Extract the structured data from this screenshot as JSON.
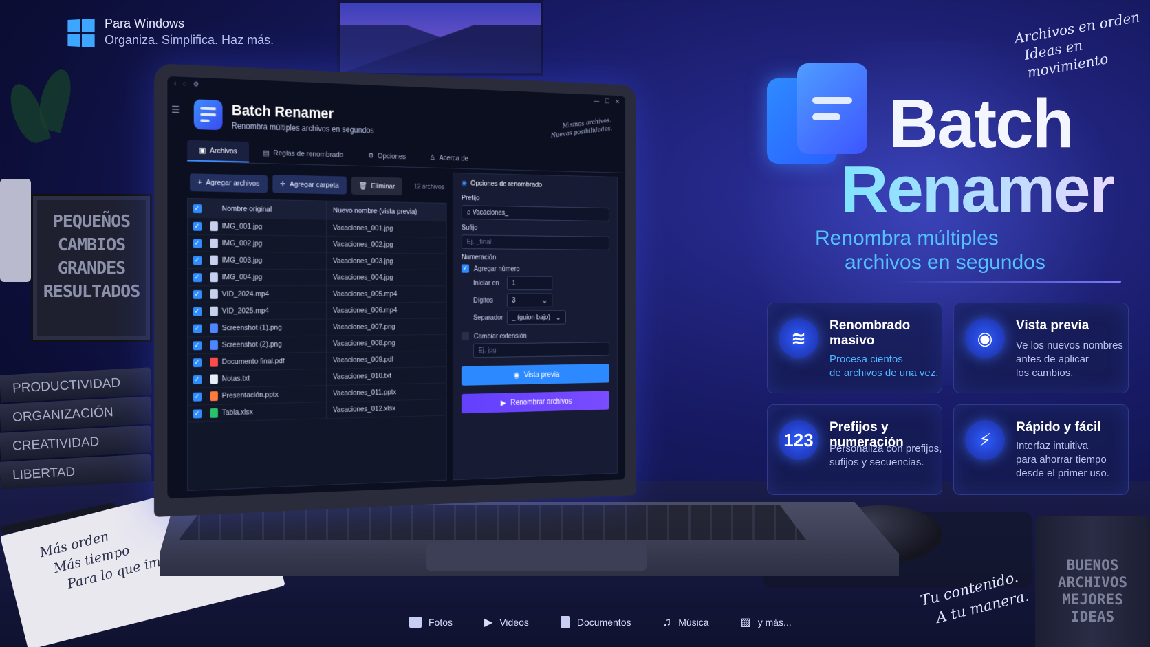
{
  "brand": {
    "os_label": "Para Windows",
    "tagline": "Organiza. Simplifica. Haz más."
  },
  "corner_note": [
    "Archivos en orden",
    "Ideas en movimiento"
  ],
  "poster": [
    "PEQUEÑOS",
    "CAMBIOS",
    "GRANDES",
    "RESULTADOS"
  ],
  "books": [
    "PRODUCTIVIDAD",
    "ORGANIZACIÓN",
    "CREATIVIDAD",
    "LIBERTAD"
  ],
  "notebook": [
    "Más orden",
    "Más tiempo",
    "Para lo que importa"
  ],
  "mug": [
    "BUENOS",
    "ARCHIVOS",
    "MEJORES",
    "IDEAS"
  ],
  "app": {
    "title": "Batch Renamer",
    "subtitle": "Renombra múltiples archivos en segundos",
    "header_note": [
      "Mismos archivos.",
      "Nuevas posibilidades."
    ],
    "tabs": [
      {
        "label": "Archivos",
        "icon": "folder-icon"
      },
      {
        "label": "Reglas de renombrado",
        "icon": "list-icon"
      },
      {
        "label": "Opciones",
        "icon": "gear-icon"
      },
      {
        "label": "Acerca de",
        "icon": "user-icon"
      }
    ],
    "toolbar": {
      "add_files": "Agregar archivos",
      "add_folder": "Agregar carpeta",
      "delete": "Eliminar",
      "count": "12 archivos"
    },
    "table": {
      "col_original": "Nombre original",
      "col_new": "Nuevo nombre (vista previa)",
      "rows": [
        {
          "orig": "IMG_001.jpg",
          "new": "Vacaciones_001.jpg",
          "type": "image"
        },
        {
          "orig": "IMG_002.jpg",
          "new": "Vacaciones_002.jpg",
          "type": "image"
        },
        {
          "orig": "IMG_003.jpg",
          "new": "Vacaciones_003.jpg",
          "type": "image"
        },
        {
          "orig": "IMG_004.jpg",
          "new": "Vacaciones_004.jpg",
          "type": "image"
        },
        {
          "orig": "VID_2024.mp4",
          "new": "Vacaciones_005.mp4",
          "type": "video"
        },
        {
          "orig": "VID_2025.mp4",
          "new": "Vacaciones_006.mp4",
          "type": "video"
        },
        {
          "orig": "Screenshot (1).png",
          "new": "Vacaciones_007.png",
          "type": "doc"
        },
        {
          "orig": "Screenshot (2).png",
          "new": "Vacaciones_008.png",
          "type": "doc"
        },
        {
          "orig": "Documento final.pdf",
          "new": "Vacaciones_009.pdf",
          "type": "pdf"
        },
        {
          "orig": "Notas.txt",
          "new": "Vacaciones_010.txt",
          "type": "txt"
        },
        {
          "orig": "Presentación.pptx",
          "new": "Vacaciones_011.pptx",
          "type": "pptx"
        },
        {
          "orig": "Tabla.xlsx",
          "new": "Vacaciones_012.xlsx",
          "type": "xlsx"
        }
      ]
    },
    "panel": {
      "title": "Opciones de renombrado",
      "prefix_label": "Prefijo",
      "prefix_value": "Vacaciones_",
      "suffix_label": "Sufijo",
      "suffix_placeholder": "Ej. _final",
      "numbering_label": "Numeración",
      "add_number": "Agregar número",
      "start_label": "Iniciar en",
      "start_value": "1",
      "digits_label": "Dígitos",
      "digits_value": "3",
      "separator_label": "Separador",
      "separator_value": "_ (guion bajo)",
      "change_ext": "Cambiar extensión",
      "ext_placeholder": "Ej. jpg",
      "preview_btn": "Vista previa",
      "rename_btn": "Renombrar archivos"
    }
  },
  "hero": {
    "line1": "Batch",
    "line2": "Renamer",
    "tag1": "Renombra múltiples",
    "tag2": "archivos en segundos"
  },
  "cards": [
    {
      "title": "Renombrado masivo",
      "desc": [
        "Procesa cientos",
        "de archivos de una vez."
      ],
      "icon": "layers-icon"
    },
    {
      "title": "Vista previa",
      "desc": [
        "Ve los nuevos nombres",
        "antes de aplicar",
        "los cambios."
      ],
      "icon": "eye-icon"
    },
    {
      "title": "Prefijos y numeración",
      "icon_text": "123",
      "desc": [
        "Personaliza con prefijos,",
        "sufijos y secuencias."
      ],
      "icon": "numbers-icon"
    },
    {
      "title": "Rápido y fácil",
      "desc": [
        "Interfaz intuitiva",
        "para ahorrar tiempo",
        "desde el primer uso."
      ],
      "icon": "lightning-icon"
    }
  ],
  "bottom_note": [
    "Tu contenido.",
    "A tu manera."
  ],
  "footer": [
    {
      "label": "Fotos",
      "icon": "folder-icon"
    },
    {
      "label": "Videos",
      "icon": "play-icon"
    },
    {
      "label": "Documentos",
      "icon": "document-icon"
    },
    {
      "label": "Música",
      "icon": "music-icon"
    },
    {
      "label": "y más...",
      "icon": "image-icon"
    }
  ]
}
